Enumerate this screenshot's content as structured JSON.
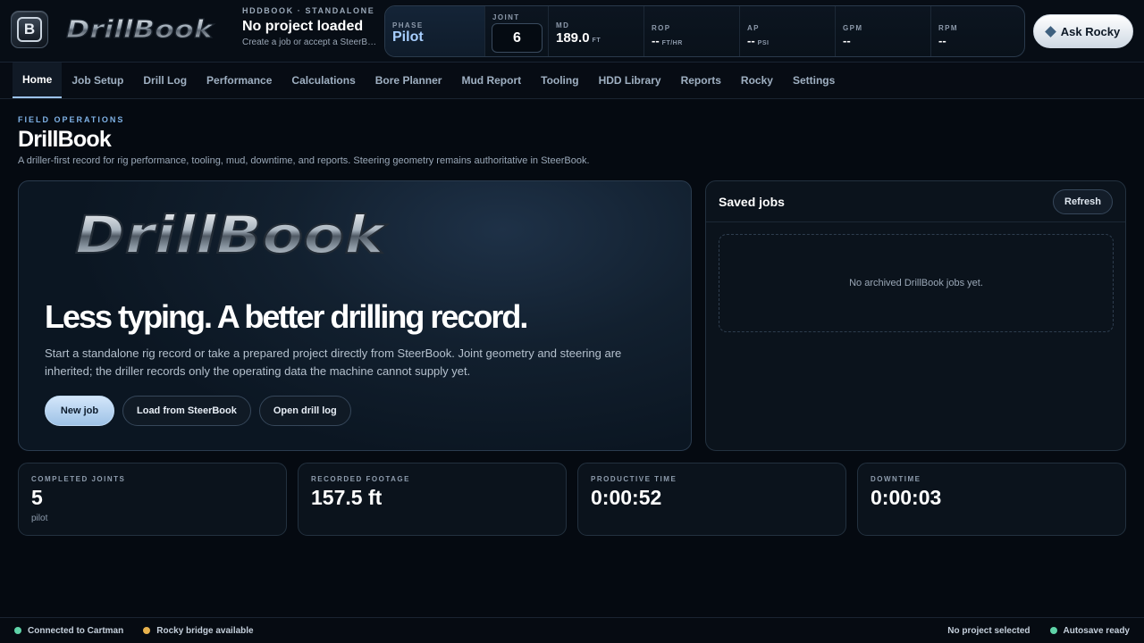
{
  "header": {
    "badge_letter": "B",
    "logo_text": "DrillBook",
    "project_eyebrow": "HDDBOOK · STANDALONE",
    "project_title": "No project loaded",
    "project_sub": "Create a job or accept a SteerBook handoff."
  },
  "telemetry": {
    "phase": {
      "label": "PHASE",
      "value": "Pilot"
    },
    "joint": {
      "label": "JOINT",
      "value": "6"
    },
    "md": {
      "label": "MD",
      "value": "189.0",
      "unit": "FT"
    },
    "rop": {
      "label": "ROP",
      "value": "--",
      "unit": "FT/HR"
    },
    "ap": {
      "label": "AP",
      "value": "--",
      "unit": "PSI"
    },
    "gpm": {
      "label": "GPM",
      "value": "--"
    },
    "rpm": {
      "label": "RPM",
      "value": "--"
    }
  },
  "ask_rocky": {
    "label": "Ask Rocky",
    "icon": "diamond-icon"
  },
  "nav": {
    "tabs": [
      {
        "label": "Home",
        "active": true
      },
      {
        "label": "Job Setup"
      },
      {
        "label": "Drill Log"
      },
      {
        "label": "Performance"
      },
      {
        "label": "Calculations"
      },
      {
        "label": "Bore Planner"
      },
      {
        "label": "Mud Report"
      },
      {
        "label": "Tooling"
      },
      {
        "label": "HDD Library"
      },
      {
        "label": "Reports"
      },
      {
        "label": "Rocky"
      },
      {
        "label": "Settings"
      }
    ]
  },
  "page": {
    "eyebrow": "FIELD OPERATIONS",
    "title": "DrillBook",
    "description": "A driller-first record for rig performance, tooling, mud, downtime, and reports. Steering geometry remains authoritative in SteerBook."
  },
  "hero": {
    "logo_text": "DrillBook",
    "headline": "Less typing. A better drilling record.",
    "body": "Start a standalone rig record or take a prepared project directly from SteerBook. Joint geometry and steering are inherited; the driller records only the operating data the machine cannot supply yet.",
    "buttons": {
      "new_job": "New job",
      "load_steerbook": "Load from SteerBook",
      "open_log": "Open drill log"
    }
  },
  "saved_jobs": {
    "title": "Saved jobs",
    "refresh_label": "Refresh",
    "empty_text": "No archived DrillBook jobs yet."
  },
  "stats": [
    {
      "label": "COMPLETED JOINTS",
      "value": "5",
      "sub": "pilot"
    },
    {
      "label": "RECORDED FOOTAGE",
      "value": "157.5 ft",
      "sub": ""
    },
    {
      "label": "PRODUCTIVE TIME",
      "value": "0:00:52",
      "sub": ""
    },
    {
      "label": "DOWNTIME",
      "value": "0:00:03",
      "sub": ""
    }
  ],
  "status": {
    "left": [
      {
        "label": "Connected to Cartman",
        "color": "#5fd3a8"
      },
      {
        "label": "Rocky bridge available",
        "color": "#e7b24d"
      }
    ],
    "right": [
      {
        "label": "No project selected",
        "color": null
      },
      {
        "label": "Autosave ready",
        "color": "#5fd3a8"
      }
    ]
  },
  "colors": {
    "accent": "#9cc3ee",
    "phase_text": "#a8cfff",
    "background": "#050a11",
    "ok": "#5fd3a8",
    "warn": "#e7b24d"
  }
}
